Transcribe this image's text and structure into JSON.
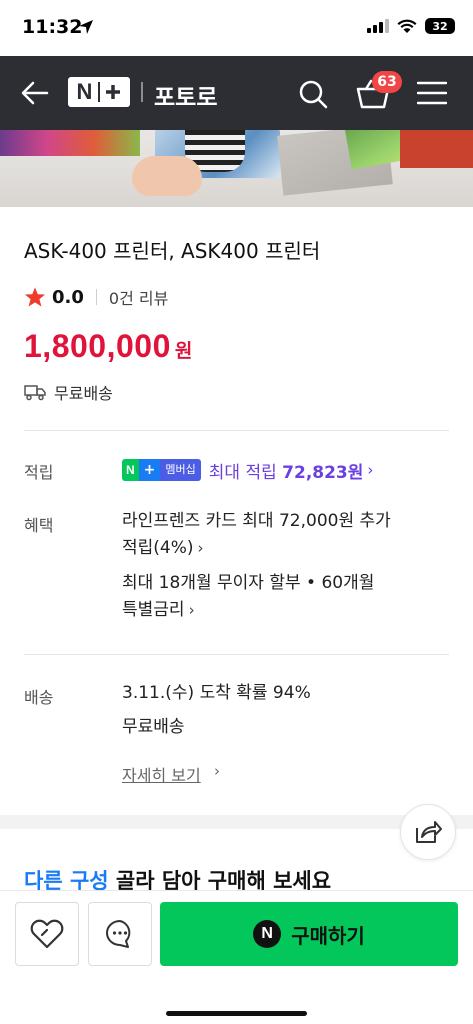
{
  "status_bar": {
    "time": "11:32",
    "battery": "32"
  },
  "header": {
    "logo_text": "N+",
    "store_name": "포토로",
    "cart_count": "63"
  },
  "product": {
    "title": "ASK-400 프린터, ASK400 프린터",
    "rating": "0.0",
    "review_count": "0건 리뷰",
    "price": "1,800,000",
    "price_unit": "원",
    "shipping": "무료배송"
  },
  "membership": {
    "label": "적립",
    "badge_text": "멤버십",
    "text_prefix": "최대 적립 ",
    "amount": "72,823원"
  },
  "benefits": {
    "label": "혜택",
    "line1": "라인프렌즈 카드 최대 72,000원 추가",
    "line1b": "적립(4%)",
    "line2": "최대 18개월 무이자 할부 • 60개월",
    "line2b": "특별금리"
  },
  "delivery": {
    "label": "배송",
    "arrival": "3.11.(수) 도착 확률 94%",
    "fee": "무료배송",
    "detail_link": "자세히 보기"
  },
  "section": {
    "title_highlight": "다른 구성",
    "title_rest": " 골라 담아 구매해 보세요"
  },
  "bottom_bar": {
    "buy_label": "구매하기",
    "buy_badge": "N"
  },
  "colors": {
    "header_bg": "#2c2e33",
    "price": "#e0133b",
    "membership": "#6b3fe0",
    "buy_button": "#03c75a",
    "badge": "#f04646"
  },
  "icons": [
    "location-arrow-icon",
    "signal-icon",
    "wifi-icon",
    "back-arrow-icon",
    "search-icon",
    "cart-icon",
    "menu-icon",
    "star-icon",
    "truck-icon",
    "share-icon",
    "heart-icon",
    "chat-icon"
  ]
}
